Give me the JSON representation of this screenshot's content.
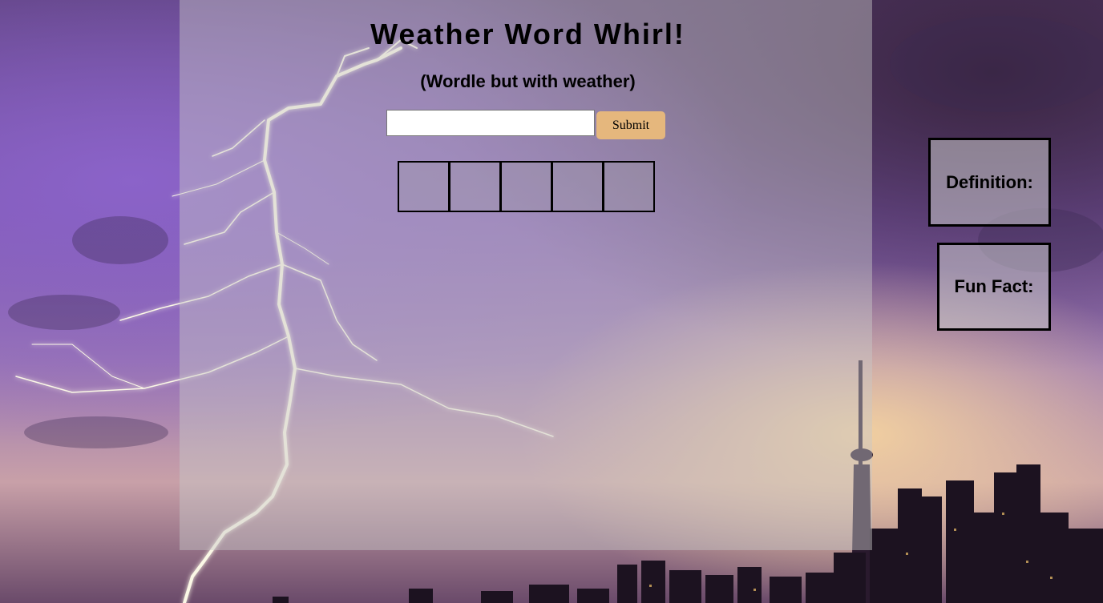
{
  "header": {
    "title": "Weather Word Whirl!",
    "subtitle": "(Wordle but with weather)"
  },
  "guess_form": {
    "input_value": "",
    "input_placeholder": "",
    "submit_label": "Submit"
  },
  "board": {
    "tiles": [
      "",
      "",
      "",
      "",
      ""
    ]
  },
  "side_panels": {
    "definition_label": "Definition:",
    "fun_fact_label": "Fun Fact:"
  },
  "colors": {
    "submit_button": "#e5b77d",
    "panel_overlay": "rgba(200,200,200,0.45)",
    "tile_border": "#000000"
  },
  "background": {
    "scene": "lightning-storm-city-skyline"
  }
}
